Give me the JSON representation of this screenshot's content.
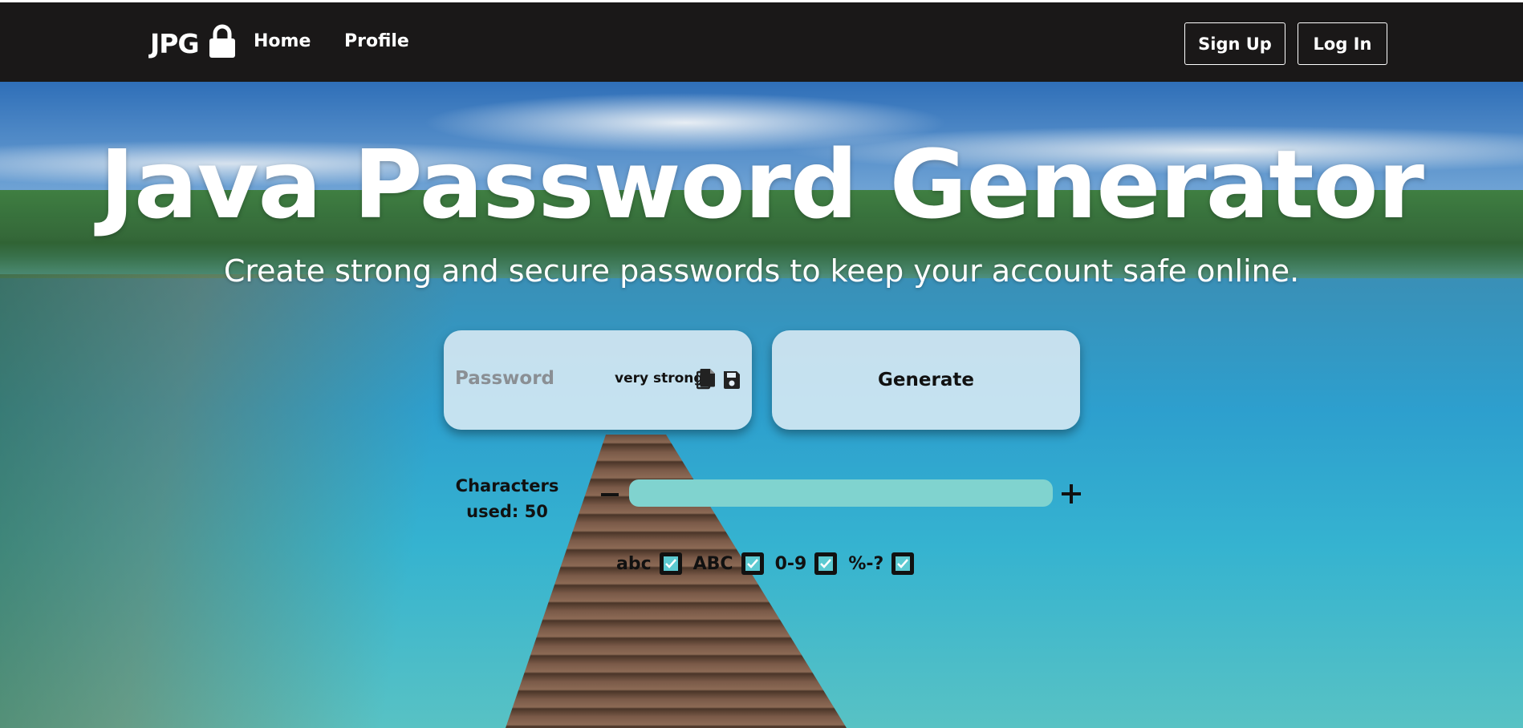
{
  "nav": {
    "brand": "JPG",
    "brand_icon": "lock-icon",
    "links": [
      {
        "label": "Home"
      },
      {
        "label": "Profile"
      }
    ],
    "signup_label": "Sign Up",
    "login_label": "Log In"
  },
  "hero": {
    "title": "Java Password Generator",
    "subtitle": "Create strong and secure passwords to keep your account safe online."
  },
  "password": {
    "placeholder": "Password",
    "strength": "very strong",
    "icons": [
      "copy-icon",
      "save-icon"
    ]
  },
  "generate": {
    "label": "Generate"
  },
  "characters": {
    "label": "Characters used: 50",
    "value": 50
  },
  "options": [
    {
      "label": "abc",
      "checked": true
    },
    {
      "label": "ABC",
      "checked": true
    },
    {
      "label": "0-9",
      "checked": true
    },
    {
      "label": "%-?",
      "checked": true
    }
  ],
  "colors": {
    "navbar": "#1a1818",
    "slider": "#80d3cf",
    "checkbox_fill": "#5ccad2",
    "card": "#e6f0f8"
  }
}
